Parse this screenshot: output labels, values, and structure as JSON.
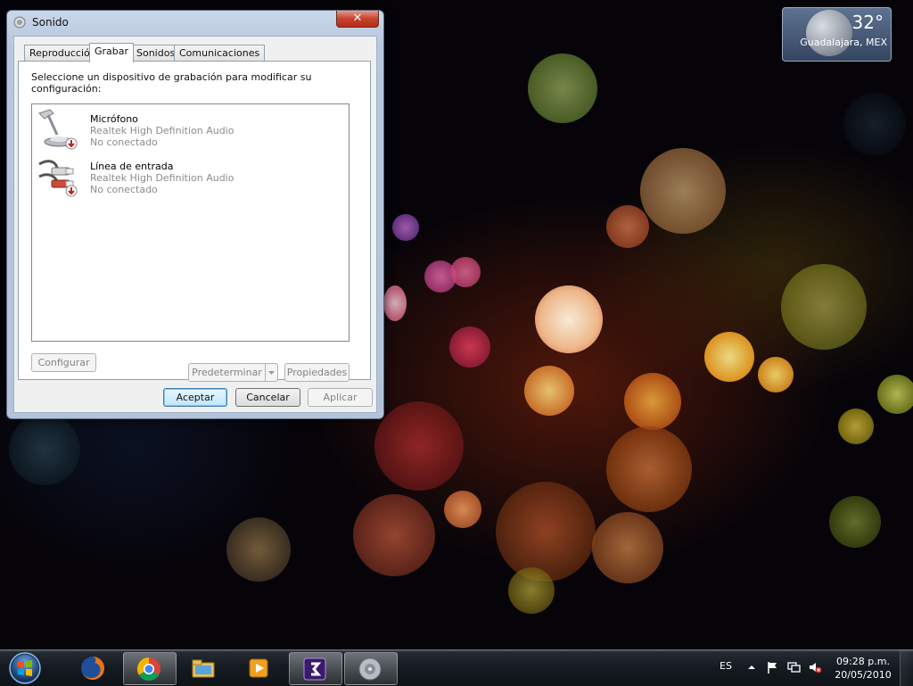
{
  "window": {
    "title": "Sonido",
    "close_glyph": "✕",
    "tabs": [
      {
        "label": "Reproducción"
      },
      {
        "label": "Grabar",
        "active": true
      },
      {
        "label": "Sonidos"
      },
      {
        "label": "Comunicaciones"
      }
    ],
    "instructions": "Seleccione un dispositivo de grabación para modificar su configuración:",
    "devices": [
      {
        "name": "Micrófono",
        "driver": "Realtek High Definition Audio",
        "status": "No conectado",
        "icon": "microphone-icon"
      },
      {
        "name": "Línea de entrada",
        "driver": "Realtek High Definition Audio",
        "status": "No conectado",
        "icon": "line-in-jack-icon"
      }
    ],
    "buttons": {
      "configure": "Configurar",
      "set_default": "Predeterminar",
      "properties": "Propiedades",
      "ok": "Aceptar",
      "cancel": "Cancelar",
      "apply": "Aplicar"
    }
  },
  "weather": {
    "temperature": "32°",
    "city": "Guadalajara, MEX"
  },
  "taskbar": {
    "items": [
      {
        "icon": "firefox-icon",
        "active": false
      },
      {
        "icon": "chrome-icon",
        "active": true
      },
      {
        "icon": "explorer-folder-icon",
        "active": false
      },
      {
        "icon": "media-player-icon",
        "active": false
      },
      {
        "icon": "app-3-icon",
        "active": true
      },
      {
        "icon": "speaker-icon",
        "active": true
      }
    ],
    "language": "ES",
    "clock_time": "09:28 p.m.",
    "clock_date": "20/05/2010"
  },
  "colors": {
    "accent": "#3c7fb1",
    "close": "#c6422c",
    "disabled_text": "#838383"
  }
}
